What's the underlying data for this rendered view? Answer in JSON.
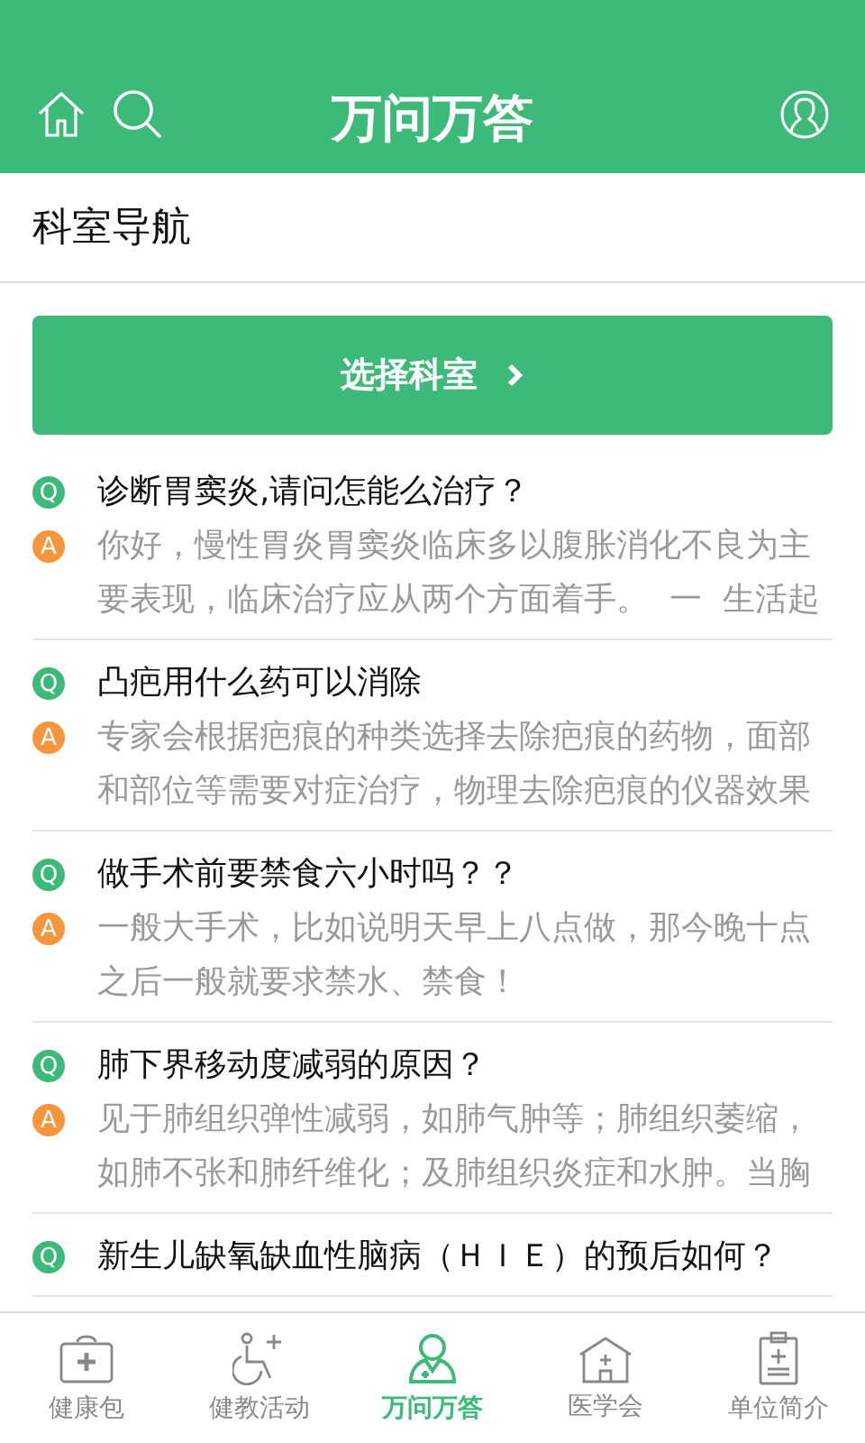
{
  "header": {
    "title": "万问万答"
  },
  "section": {
    "title": "科室导航"
  },
  "select_button": {
    "label": "选择科室"
  },
  "qa_list": [
    {
      "question_badge": "Q",
      "question": "诊断胃窦炎,请问怎能么治疗？",
      "answer_badge": "A",
      "answer": "你好，慢性胃炎胃窦炎临床多以腹胀消化不良为主要表现，临床治疗应从两个方面着手。  一  生活起"
    },
    {
      "question_badge": "Q",
      "question": "凸疤用什么药可以消除",
      "answer_badge": "A",
      "answer": "专家会根据疤痕的种类选择去除疤痕的药物，面部和部位等需要对症治疗，物理去除疤痕的仪器效果"
    },
    {
      "question_badge": "Q",
      "question": "做手术前要禁食六小时吗？？",
      "answer_badge": "A",
      "answer": "一般大手术，比如说明天早上八点做，那今晚十点之后一般就要求禁水、禁食！"
    },
    {
      "question_badge": "Q",
      "question": "肺下界移动度减弱的原因？",
      "answer_badge": "A",
      "answer": "见于肺组织弹性减弱，如肺气肿等；肺组织萎缩，如肺不张和肺纤维化；及肺组织炎症和水肿。当胸"
    },
    {
      "question_badge": "Q",
      "question": "新生儿缺氧缺血性脑病（ＨＩＥ）的预后如何？"
    }
  ],
  "tabs": [
    {
      "kind": "kit",
      "label": "健康包",
      "selected": false
    },
    {
      "kind": "activity",
      "label": "健教活动",
      "selected": false
    },
    {
      "kind": "doctor",
      "label": "万问万答",
      "selected": true
    },
    {
      "kind": "hospital",
      "label": "医学会",
      "selected": false
    },
    {
      "kind": "clipboard",
      "label": "单位简介",
      "selected": false
    }
  ]
}
